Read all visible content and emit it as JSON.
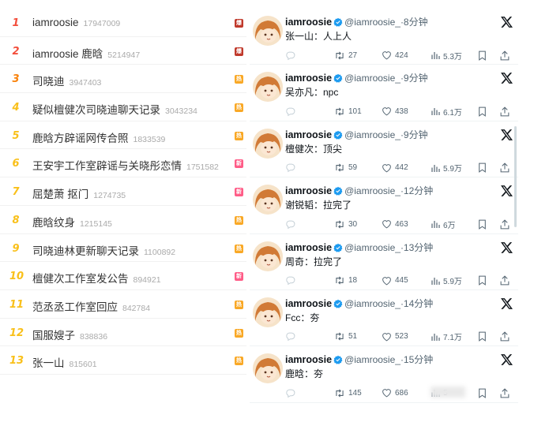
{
  "hot_search": {
    "items": [
      {
        "rank": "1",
        "title": "iamroosie",
        "count": "17947009",
        "badge": "爆",
        "badge_color": "#c0392b",
        "rank_color": "#f34e3c"
      },
      {
        "rank": "2",
        "title": "iamroosie 鹿晗",
        "count": "5214947",
        "badge": "爆",
        "badge_color": "#c0392b",
        "rank_color": "#f34e3c"
      },
      {
        "rank": "3",
        "title": "司晓迪",
        "count": "3947403",
        "badge": "热",
        "badge_color": "#f9a825",
        "rank_color": "#f9820b"
      },
      {
        "rank": "4",
        "title": "疑似檀健次司晓迪聊天记录",
        "count": "3043234",
        "badge": "热",
        "badge_color": "#f9a825",
        "rank_color": "#f9c01a"
      },
      {
        "rank": "5",
        "title": "鹿晗方辟谣网传合照",
        "count": "1833539",
        "badge": "热",
        "badge_color": "#f9a825",
        "rank_color": "#f9c01a"
      },
      {
        "rank": "6",
        "title": "王安宇工作室辟谣与关晓彤恋情",
        "count": "1751582",
        "badge": "新",
        "badge_color": "#ff5c87",
        "rank_color": "#f9c01a"
      },
      {
        "rank": "7",
        "title": "屈楚萧 抠门",
        "count": "1274735",
        "badge": "新",
        "badge_color": "#ff5c87",
        "rank_color": "#f9c01a"
      },
      {
        "rank": "8",
        "title": "鹿晗纹身",
        "count": "1215145",
        "badge": "热",
        "badge_color": "#f9a825",
        "rank_color": "#f9c01a"
      },
      {
        "rank": "9",
        "title": "司晓迪林更新聊天记录",
        "count": "1100892",
        "badge": "热",
        "badge_color": "#f9a825",
        "rank_color": "#f9c01a"
      },
      {
        "rank": "10",
        "title": "檀健次工作室发公告",
        "count": "894921",
        "badge": "新",
        "badge_color": "#ff5c87",
        "rank_color": "#f9c01a"
      },
      {
        "rank": "11",
        "title": "范丞丞工作室回应",
        "count": "842784",
        "badge": "热",
        "badge_color": "#f9a825",
        "rank_color": "#f9c01a"
      },
      {
        "rank": "12",
        "title": "国服嫂子",
        "count": "838836",
        "badge": "热",
        "badge_color": "#f9a825",
        "rank_color": "#f9c01a"
      },
      {
        "rank": "13",
        "title": "张一山",
        "count": "815601",
        "badge": "热",
        "badge_color": "#f9a825",
        "rank_color": "#f9c01a"
      }
    ]
  },
  "tweets": {
    "author_name": "iamroosie",
    "author_handle": "@iamroosie_",
    "verified_color": "#1d9bf0",
    "items": [
      {
        "time": "·8分钟",
        "text": "张一山：人上人",
        "retweets": "27",
        "likes": "424",
        "views": "5.3万"
      },
      {
        "time": "·9分钟",
        "text": "吴亦凡：npc",
        "retweets": "101",
        "likes": "438",
        "views": "6.1万"
      },
      {
        "time": "·9分钟",
        "text": "檀健次：顶尖",
        "retweets": "59",
        "likes": "442",
        "views": "5.9万"
      },
      {
        "time": "·12分钟",
        "text": "谢锐韬：拉完了",
        "retweets": "30",
        "likes": "463",
        "views": "6万"
      },
      {
        "time": "·13分钟",
        "text": "周奇：拉完了",
        "retweets": "18",
        "likes": "445",
        "views": "5.9万"
      },
      {
        "time": "·14分钟",
        "text": "Fcc：夯",
        "retweets": "51",
        "likes": "523",
        "views": "7.1万"
      },
      {
        "time": "·15分钟",
        "text": "鹿晗：夯",
        "retweets": "145",
        "likes": "686",
        "views": "5"
      }
    ]
  },
  "icons": {
    "platform": "x-logo-icon",
    "verified": "verified-badge-icon",
    "reply": "reply-icon",
    "retweet": "retweet-icon",
    "like": "heart-icon",
    "views": "views-bar-chart-icon",
    "bookmark": "bookmark-icon",
    "share": "share-icon"
  }
}
